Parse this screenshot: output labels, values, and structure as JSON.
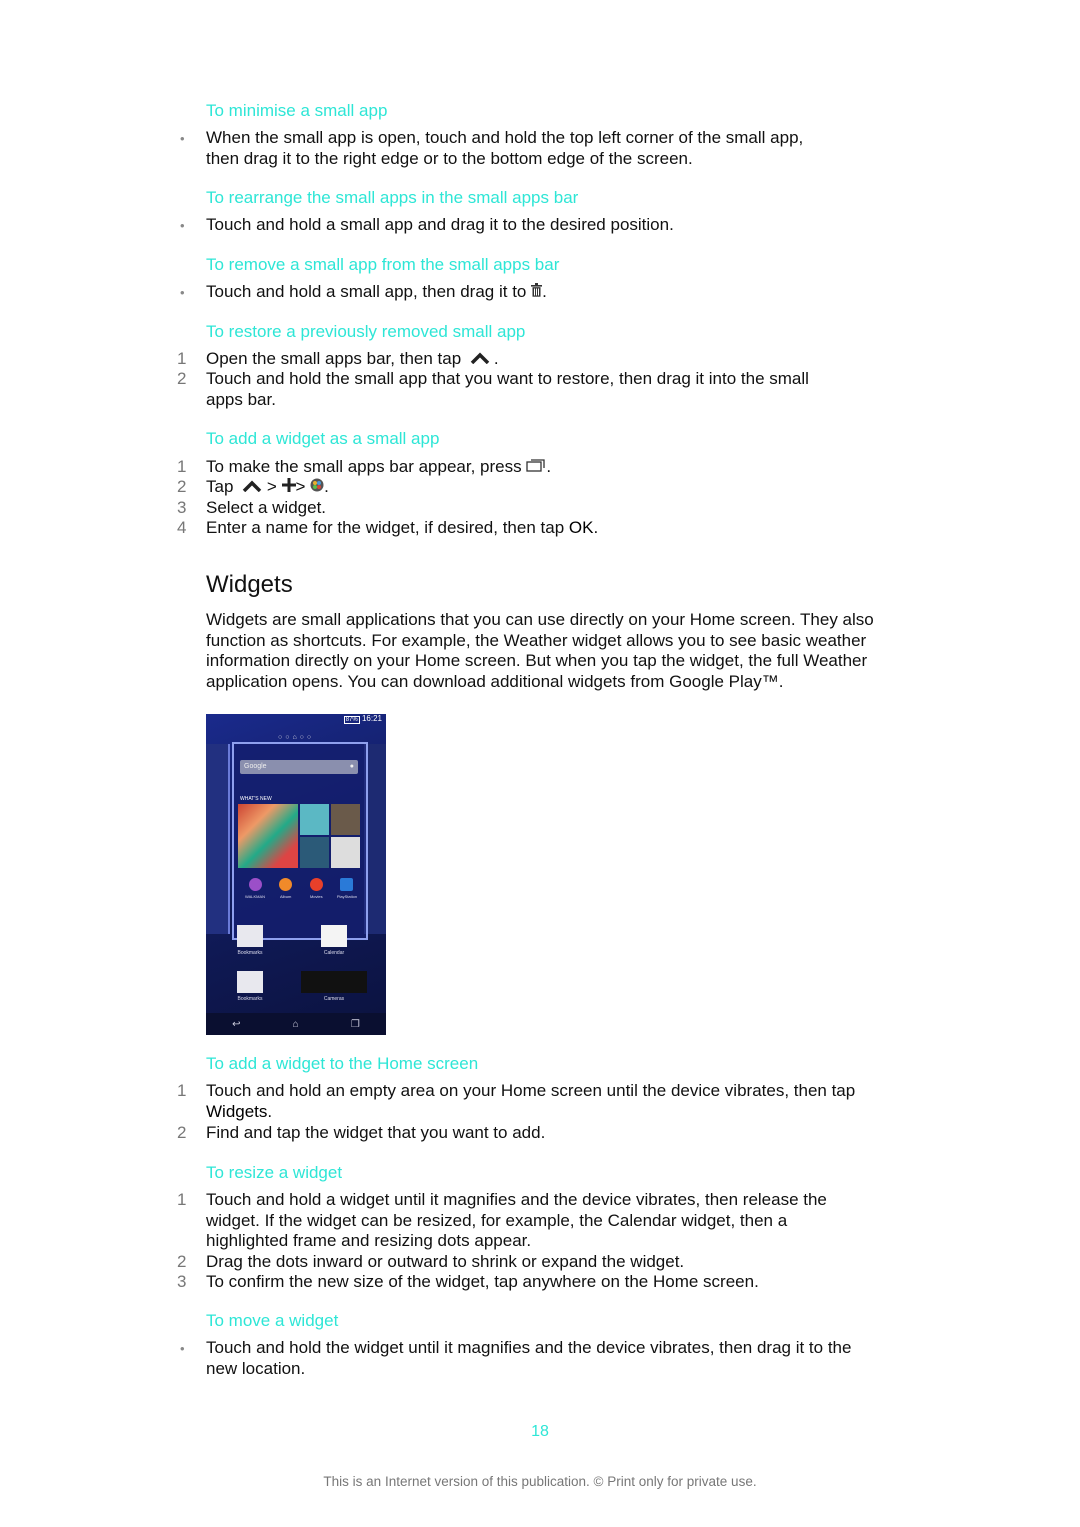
{
  "colors": {
    "heading": "#2ee6d6",
    "body": "#111111",
    "muted": "#777777"
  },
  "sections": {
    "minimise": {
      "heading": "To minimise a small app",
      "bullet": "•",
      "text": "When the small app is open, touch and hold the top left corner of the small app, then drag it to the right edge or to the bottom edge of the screen."
    },
    "rearrange": {
      "heading": "To rearrange the small apps in the small apps bar",
      "bullet": "•",
      "text": "Touch and hold a small app and drag it to the desired position."
    },
    "remove": {
      "heading": "To remove a small app from the small apps bar",
      "bullet": "•",
      "text_before_icon": "Touch and hold a small app, then drag it to ",
      "icon": "trash-icon",
      "text_after_icon": "."
    },
    "restore": {
      "heading": "To restore a previously removed small app",
      "steps": [
        {
          "n": "1",
          "text_before_icon": "Open the small apps bar, then tap ",
          "icon": "chevron-up-icon",
          "text_after_icon": "."
        },
        {
          "n": "2",
          "text": "Touch and hold the small app that you want to restore, then drag it into the small apps bar."
        }
      ]
    },
    "add_widget_small_app": {
      "heading": "To add a widget as a small app",
      "steps": [
        {
          "n": "1",
          "text_before_icon": "To make the small apps bar appear, press ",
          "icon": "recent-apps-icon",
          "text_after_icon": "."
        },
        {
          "n": "2",
          "text_tap": "Tap ",
          "sep1": " > ",
          "sep2": "> ",
          "end": "."
        },
        {
          "n": "3",
          "text": "Select a widget."
        },
        {
          "n": "4",
          "text_before": "Enter a name for the widget, if desired, then tap ",
          "bold": "OK",
          "text_after": "."
        }
      ]
    },
    "widgets": {
      "title": "Widgets",
      "intro": "Widgets are small applications that you can use directly on your Home screen. They also function as shortcuts. For example, the Weather widget allows you to see basic weather information directly on your Home screen. But when you tap the widget, the full Weather application opens. You can download additional widgets from Google Play™."
    },
    "add_widget_home": {
      "heading": "To add a widget to the Home screen",
      "steps": [
        {
          "n": "1",
          "text_before": "Touch and hold an empty area on your Home screen until the device vibrates, then tap ",
          "bold": "Widgets",
          "text_after": "."
        },
        {
          "n": "2",
          "text": "Find and tap the widget that you want to add."
        }
      ]
    },
    "resize": {
      "heading": "To resize a widget",
      "steps": [
        {
          "n": "1",
          "text": "Touch and hold a widget until it magnifies and the device vibrates, then release the widget. If the widget can be resized, for example, the Calendar widget, then a highlighted frame and resizing dots appear."
        },
        {
          "n": "2",
          "text": "Drag the dots inward or outward to shrink or expand the widget."
        },
        {
          "n": "3",
          "text": "To confirm the new size of the widget, tap anywhere on the Home screen."
        }
      ]
    },
    "move": {
      "heading": "To move a widget",
      "bullet": "•",
      "text": "Touch and hold the widget until it magnifies and the device vibrates, then drag it to the new location."
    }
  },
  "phone_screenshot": {
    "status_battery": "87%",
    "status_time": "16:21",
    "search_label": "Google",
    "whats_new_label": "WHAT'S NEW",
    "apps": [
      "WALKMAN",
      "Album",
      "Movies",
      "PlayStation"
    ],
    "widgets": [
      "Bookmarks",
      "Calendar",
      "Bookmarks",
      "Cameras"
    ],
    "nav": [
      "back-icon",
      "home-icon",
      "recent-apps-icon"
    ]
  },
  "footer": {
    "page_number": "18",
    "notice": "This is an Internet version of this publication. © Print only for private use."
  }
}
